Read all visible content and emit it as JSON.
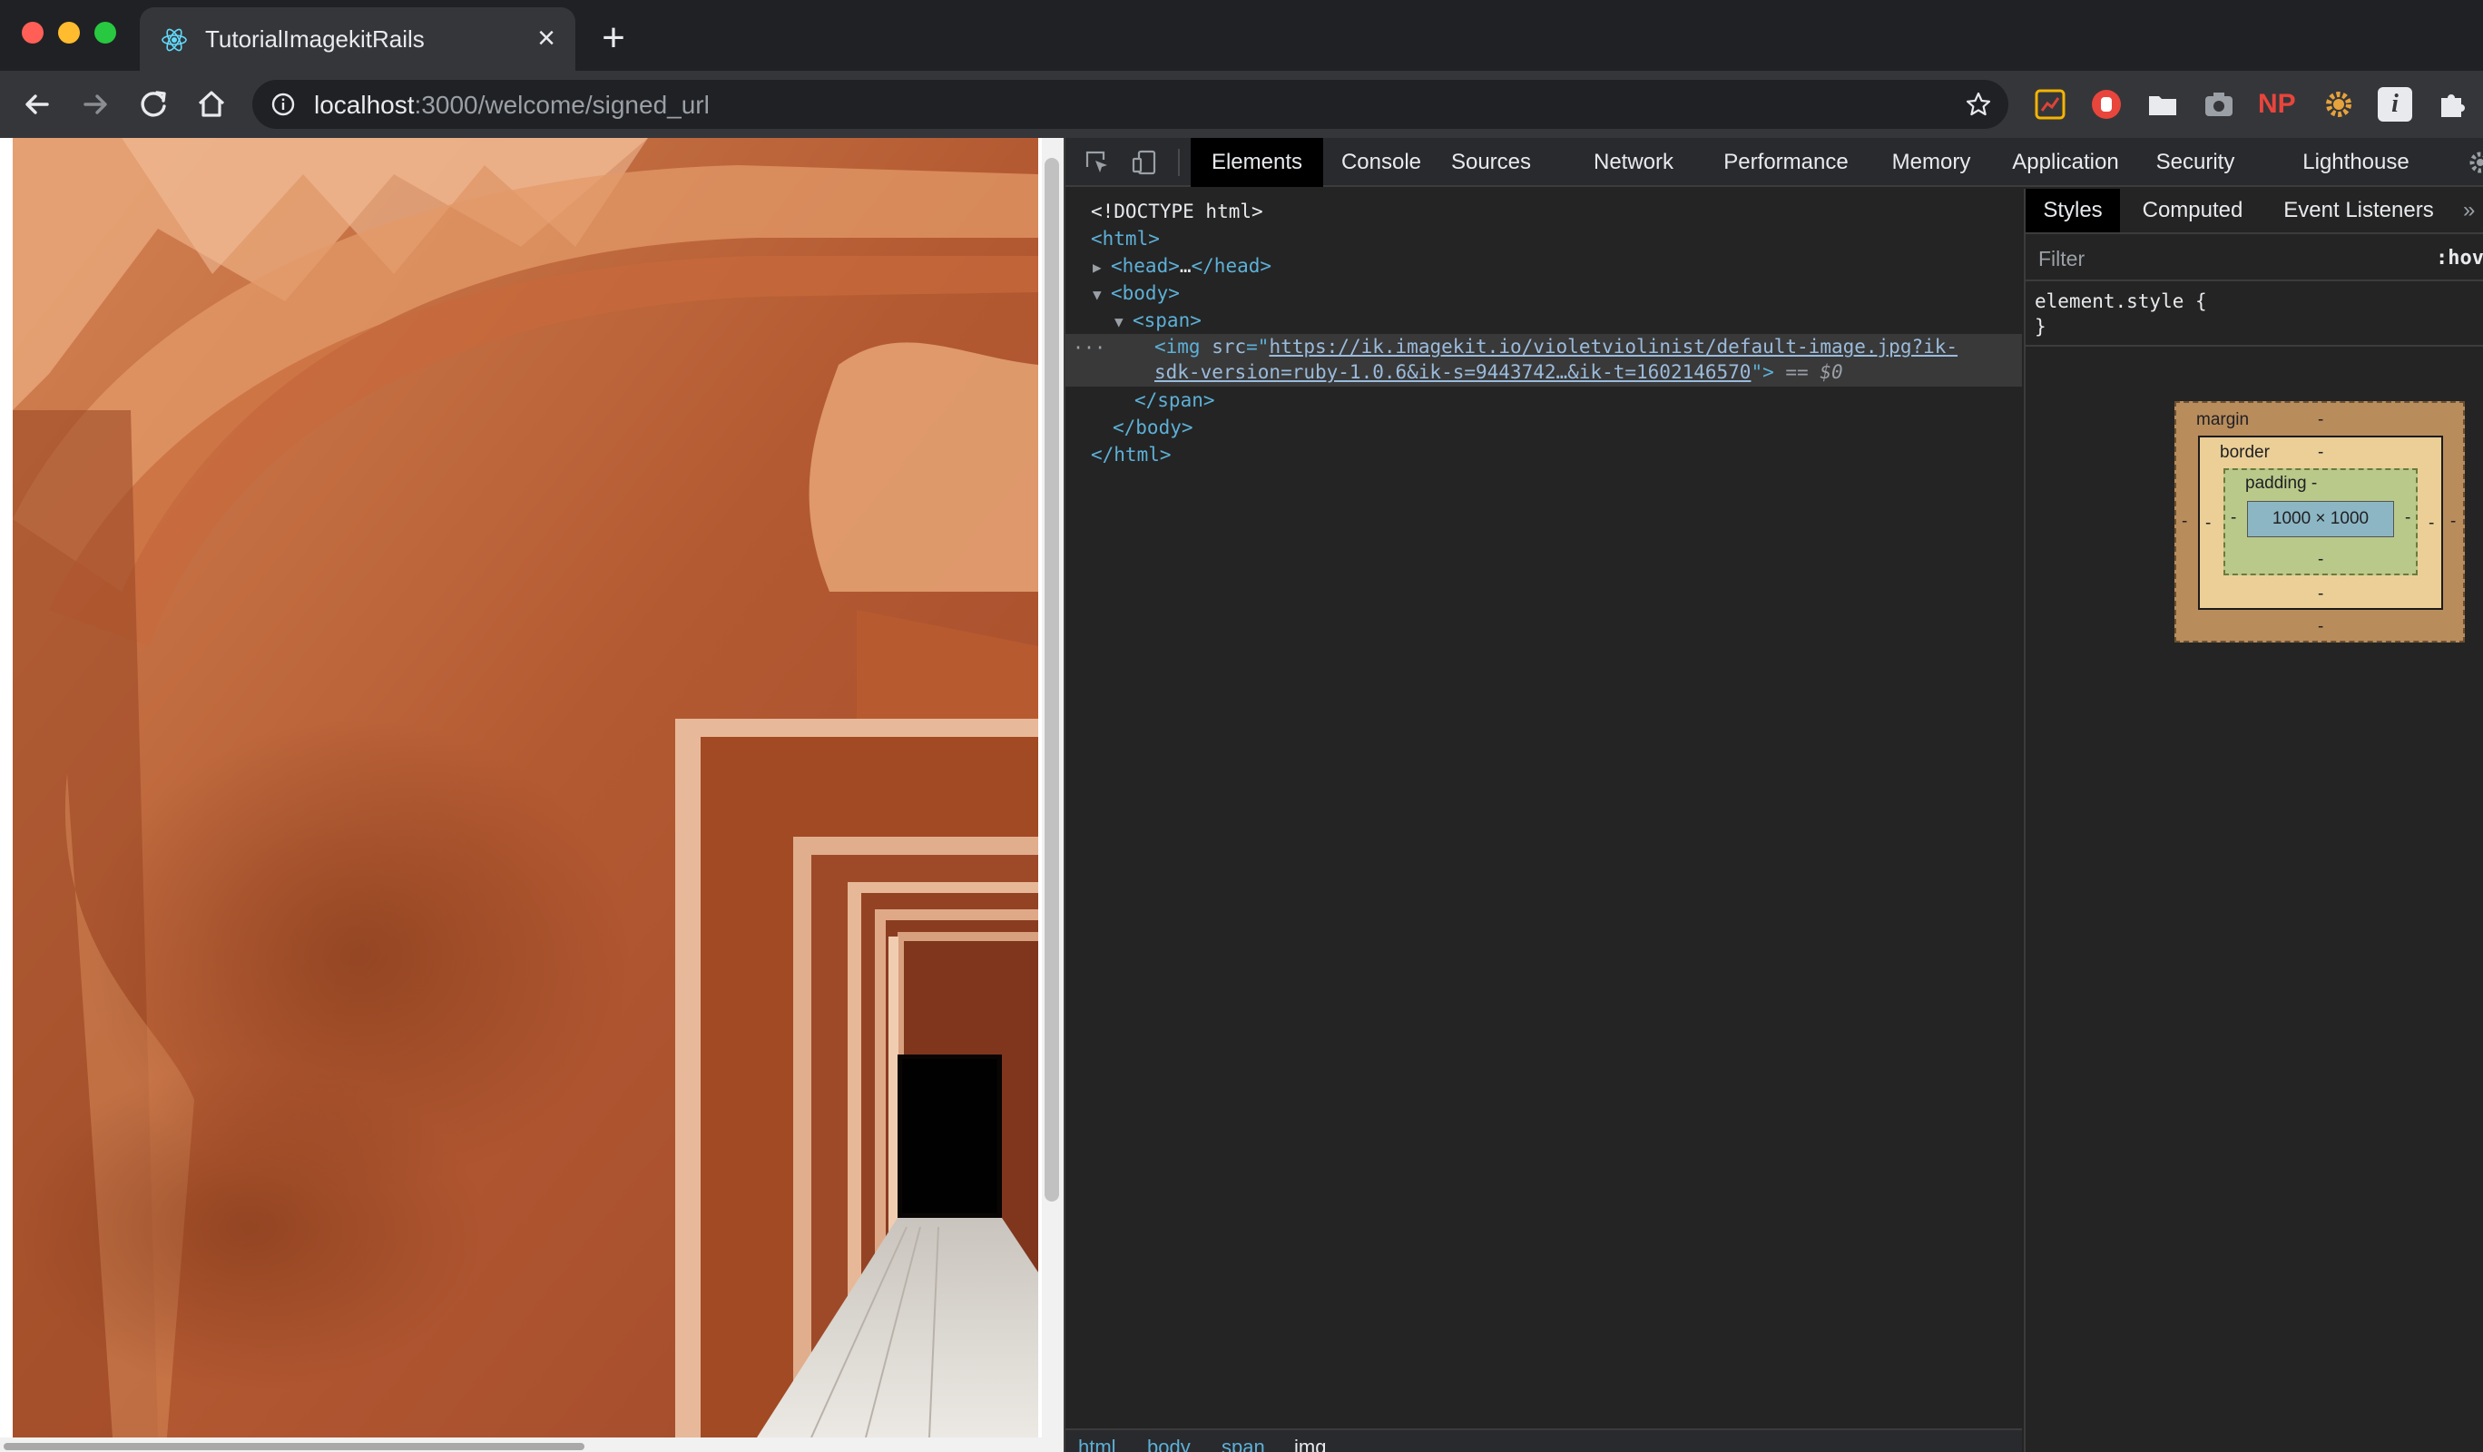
{
  "browser": {
    "tab_title": "TutorialImagekitRails",
    "tab_close": "×",
    "new_tab": "+",
    "url_host": "localhost",
    "url_path": ":3000/welcome/signed_url",
    "extensions": [
      "chart-extension-icon",
      "red-extension-icon",
      "folder-extension-icon",
      "camera-extension-icon",
      "np-extension-icon",
      "gear-extension-icon",
      "info-extension-icon",
      "puzzle-icon"
    ],
    "np_label": "NP",
    "info_label": "i"
  },
  "devtools": {
    "tabs": [
      "Elements",
      "Console",
      "Sources",
      "Network",
      "Performance",
      "Memory",
      "Application",
      "Security",
      "Lighthouse"
    ],
    "active_tab": "Elements",
    "dom": {
      "doctype": "<!DOCTYPE html>",
      "html_open": "<html>",
      "head_open": "<head>",
      "head_ellipsis": "…",
      "head_close": "</head>",
      "body_open": "<body>",
      "span_open": "<span>",
      "img_open": "<img ",
      "img_attr": "src",
      "img_eq": "=\"",
      "img_url_1": "https://ik.imagekit.io/violetviolinist/default-image.jpg?ik-",
      "img_url_2": "sdk-version=ruby-1.0.6&ik-s=9443742…&ik-t=1602146570",
      "img_close": "\">",
      "selected_marker": " == $0",
      "span_close": "</span>",
      "body_close": "</body>",
      "html_close": "</html>",
      "dots": "···"
    },
    "breadcrumbs": [
      "html",
      "body",
      "span",
      "img"
    ],
    "styles": {
      "tabs": [
        "Styles",
        "Computed",
        "Event Listeners"
      ],
      "more": "»",
      "filter_placeholder": "Filter",
      "hov": ":hov",
      "rule_open": "element.style {",
      "rule_close": "}",
      "box": {
        "margin": "margin",
        "border": "border",
        "padding": "padding -",
        "content": "1000 × 1000",
        "dash": "-"
      }
    }
  }
}
